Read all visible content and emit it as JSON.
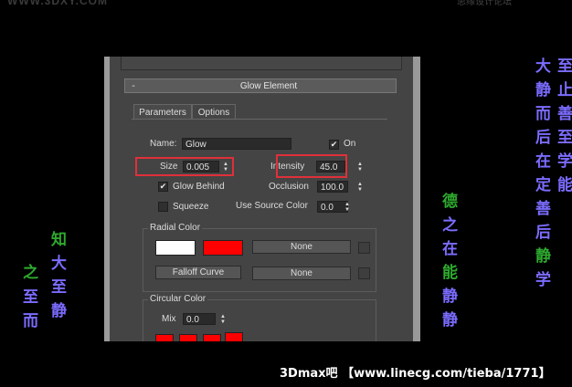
{
  "watermark": {
    "top_left": "WWW.3DXY.COM",
    "top_right": "思缘设计论坛",
    "bottom": "3Dmax吧 【www.linecg.com/tieba/1771】"
  },
  "decor": {
    "col1": [
      "至",
      "而"
    ],
    "col1b": [
      "之"
    ],
    "col2": [
      "知",
      "大",
      "至",
      "静"
    ],
    "col3": [
      "德",
      "之",
      "在",
      "能",
      "静",
      "静"
    ],
    "col4": [
      "大",
      "静",
      "而",
      "后",
      "在",
      "定",
      "善",
      "后",
      "静",
      "学"
    ],
    "col5": [
      "至",
      "止",
      "善",
      "至",
      "学",
      "能"
    ]
  },
  "panel": {
    "rollout_toggle": "-",
    "title": "Glow Element",
    "tabs": [
      "Parameters",
      "Options"
    ],
    "name_label": "Name:",
    "name_value": "Glow",
    "on_label": "On",
    "on_checked": "✔",
    "size_label": "Size",
    "size_value": "0.005",
    "intensity_label": "Intensity",
    "intensity_value": "45.0",
    "glow_behind_label": "Glow Behind",
    "glow_behind_checked": "✔",
    "occlusion_label": "Occlusion",
    "occlusion_value": "100.0",
    "squeeze_label": "Squeeze",
    "use_source_color_label": "Use Source Color",
    "use_source_color_value": "0.0",
    "radial_color_label": "Radial Color",
    "radial_swatches": [
      "#ffffff",
      "#ff0000"
    ],
    "none_label_1": "None",
    "falloff_curve_label": "Falloff Curve",
    "none_label_2": "None",
    "circular_color_label": "Circular Color",
    "mix_label": "Mix",
    "mix_value": "0.0",
    "circular_swatches": [
      "#ff0000",
      "#ff0000",
      "#ff0000",
      "#ff0000"
    ]
  },
  "colors": {
    "green": "#2eaa2e",
    "purple": "#7b6cff",
    "highlight": "#e0303a"
  }
}
